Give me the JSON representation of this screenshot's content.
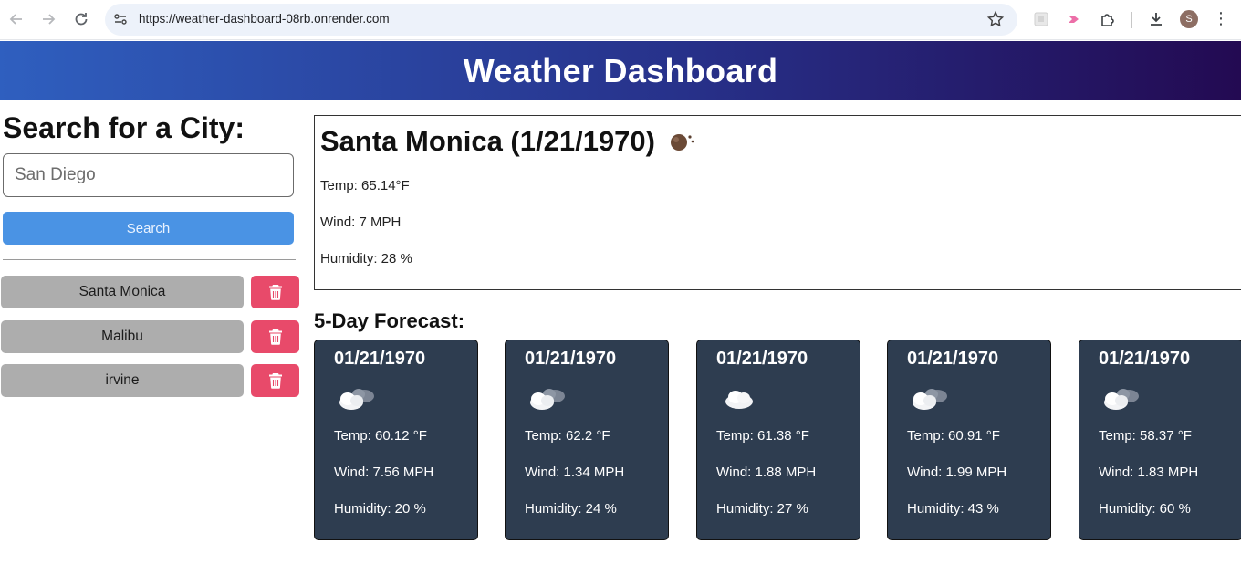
{
  "browser": {
    "url": "https://weather-dashboard-08rb.onrender.com",
    "avatar_letter": "S"
  },
  "header": {
    "title": "Weather Dashboard"
  },
  "sidebar": {
    "heading": "Search for a City:",
    "search_placeholder": "San Diego",
    "search_label": "Search",
    "history": [
      "Santa Monica",
      "Malibu",
      "irvine"
    ]
  },
  "current": {
    "title": "Santa Monica (1/21/1970)",
    "icon": "haze-icon",
    "temp": "Temp: 65.14°F",
    "wind": "Wind: 7 MPH",
    "humidity": "Humidity: 28 %"
  },
  "forecast": {
    "heading": "5-Day Forecast:",
    "days": [
      {
        "date": "01/21/1970",
        "icon": "broken-clouds-icon",
        "temp": "Temp: 60.12 °F",
        "wind": "Wind: 7.56 MPH",
        "humidity": "Humidity: 20 %"
      },
      {
        "date": "01/21/1970",
        "icon": "broken-clouds-icon",
        "temp": "Temp: 62.2 °F",
        "wind": "Wind: 1.34 MPH",
        "humidity": "Humidity: 24 %"
      },
      {
        "date": "01/21/1970",
        "icon": "cloud-icon",
        "temp": "Temp: 61.38 °F",
        "wind": "Wind: 1.88 MPH",
        "humidity": "Humidity: 27 %"
      },
      {
        "date": "01/21/1970",
        "icon": "broken-clouds-icon",
        "temp": "Temp: 60.91 °F",
        "wind": "Wind: 1.99 MPH",
        "humidity": "Humidity: 43 %"
      },
      {
        "date": "01/21/1970",
        "icon": "broken-clouds-icon",
        "temp": "Temp: 58.37 °F",
        "wind": "Wind: 1.83 MPH",
        "humidity": "Humidity: 60 %"
      }
    ]
  },
  "colors": {
    "header_start": "#2f5fbf",
    "header_end": "#230a52",
    "search_button": "#4a93e4",
    "delete_button": "#e84a6a",
    "history_button": "#adadad",
    "forecast_card": "#2e3d50"
  }
}
